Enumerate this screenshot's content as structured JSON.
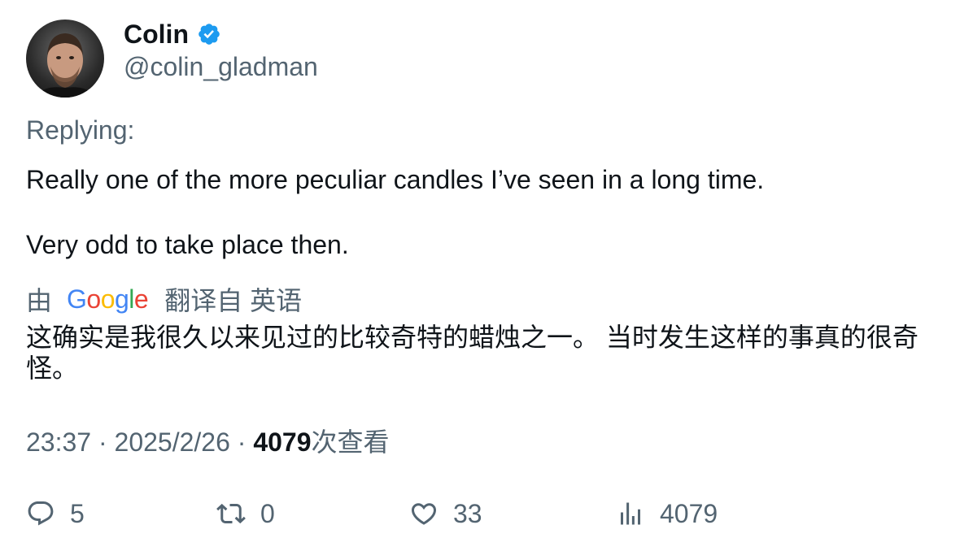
{
  "author": {
    "name": "Colin",
    "handle": "@colin_gladman",
    "verified": true
  },
  "replying_label": "Replying:",
  "tweet": {
    "line1": "Really one of the more peculiar candles I’ve seen in a long time.",
    "line2": "Very odd to take place then."
  },
  "translation": {
    "by_label": "由",
    "provider_logo": "Google",
    "from_label": "翻译自 英语",
    "text": "这确实是我很久以来见过的比较奇特的蜡烛之一。 当时发生这样的事真的很奇怪。"
  },
  "meta": {
    "time": "23:37",
    "separator": " · ",
    "date": "2025/2/26",
    "views_count": "4079",
    "views_label": "次查看"
  },
  "actions": {
    "replies": "5",
    "retweets": "0",
    "likes": "33",
    "views": "4079"
  },
  "colors": {
    "verified": "#1d9bf0",
    "secondary_text": "#536471",
    "primary_text": "#0f1419"
  }
}
